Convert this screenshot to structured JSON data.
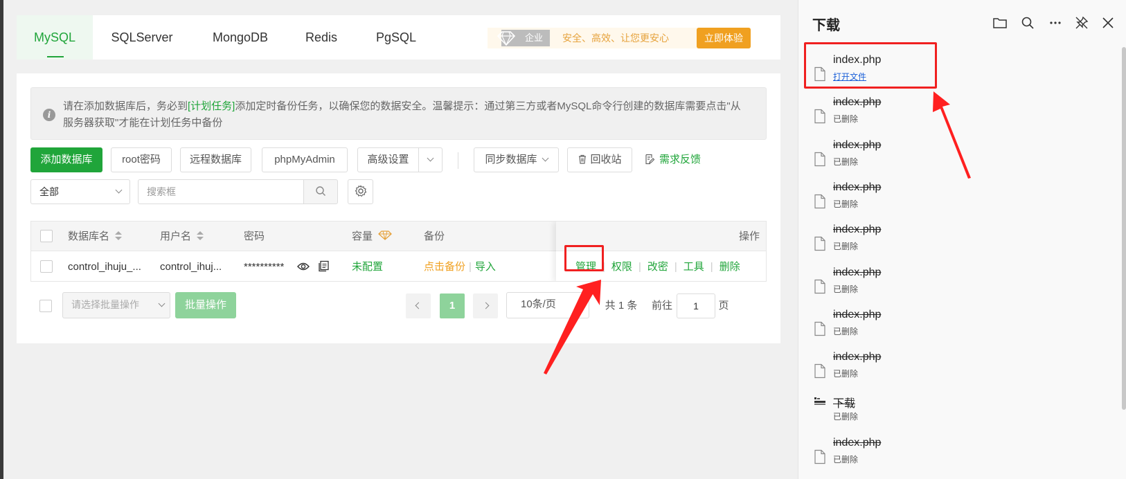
{
  "db_tabs": [
    {
      "label": "MySQL",
      "active": true
    },
    {
      "label": "SQLServer"
    },
    {
      "label": "MongoDB"
    },
    {
      "label": "Redis"
    },
    {
      "label": "PgSQL"
    }
  ],
  "promo": {
    "enterprise_label": "企业版",
    "slogan": "安全、高效、让您更安心",
    "try_button": "立即体验"
  },
  "notice": {
    "text_before": "请在添加数据库后，务必到",
    "link": "[计划任务]",
    "text_after": "添加定时备份任务，以确保您的数据安全。温馨提示：通过第三方或者MySQL命令行创建的数据库需要点击\"从服务器获取\"才能在计划任务中备份"
  },
  "toolbar": {
    "add_db": "添加数据库",
    "root_password": "root密码",
    "remote_db": "远程数据库",
    "phpmyadmin": "phpMyAdmin",
    "advanced": "高级设置",
    "sync_db": "同步数据库",
    "recycle_bin": "回收站",
    "feedback": "需求反馈"
  },
  "filter": {
    "category_value": "全部",
    "search_placeholder": "搜索框"
  },
  "table": {
    "headers": {
      "db_name": "数据库名",
      "username": "用户名",
      "password": "密码",
      "capacity": "容量",
      "backup": "备份",
      "actions": "操作"
    },
    "rows": [
      {
        "db_name": "control_ihuju_...",
        "username": "control_ihuj...",
        "password": "**********",
        "capacity": "未配置",
        "backup_link": "点击备份",
        "import_link": "导入",
        "actions": [
          "管理",
          "权限",
          "改密",
          "工具",
          "删除"
        ]
      }
    ]
  },
  "footer": {
    "batch_placeholder": "请选择批量操作",
    "batch_button": "批量操作",
    "current_page": "1",
    "page_size": "10条/页",
    "total": "共 1 条",
    "goto_label": "前往",
    "goto_value": "1",
    "page_unit": "页"
  },
  "downloads": {
    "title": "下载",
    "items": [
      {
        "name": "index.php",
        "status": "打开文件",
        "deleted": false,
        "icon": "file-icon"
      },
      {
        "name": "index.php",
        "status": "已删除",
        "deleted": true,
        "icon": "file-icon"
      },
      {
        "name": "index.php",
        "status": "已删除",
        "deleted": true,
        "icon": "file-icon"
      },
      {
        "name": "index.php",
        "status": "已删除",
        "deleted": true,
        "icon": "file-icon"
      },
      {
        "name": "index.php",
        "status": "已删除",
        "deleted": true,
        "icon": "file-icon"
      },
      {
        "name": "index.php",
        "status": "已删除",
        "deleted": true,
        "icon": "file-icon"
      },
      {
        "name": "index.php",
        "status": "已删除",
        "deleted": true,
        "icon": "file-icon"
      },
      {
        "name": "index.php",
        "status": "已删除",
        "deleted": true,
        "icon": "file-icon"
      },
      {
        "name": "下载",
        "status": "已删除",
        "deleted": true,
        "icon": "archive-icon"
      },
      {
        "name": "index.php",
        "status": "已删除",
        "deleted": true,
        "icon": "file-icon"
      }
    ]
  },
  "colors": {
    "brand_green": "#20a53a",
    "accent_orange": "#f0a020",
    "highlight_red": "#f02020",
    "link_blue": "#1a5fd8"
  }
}
